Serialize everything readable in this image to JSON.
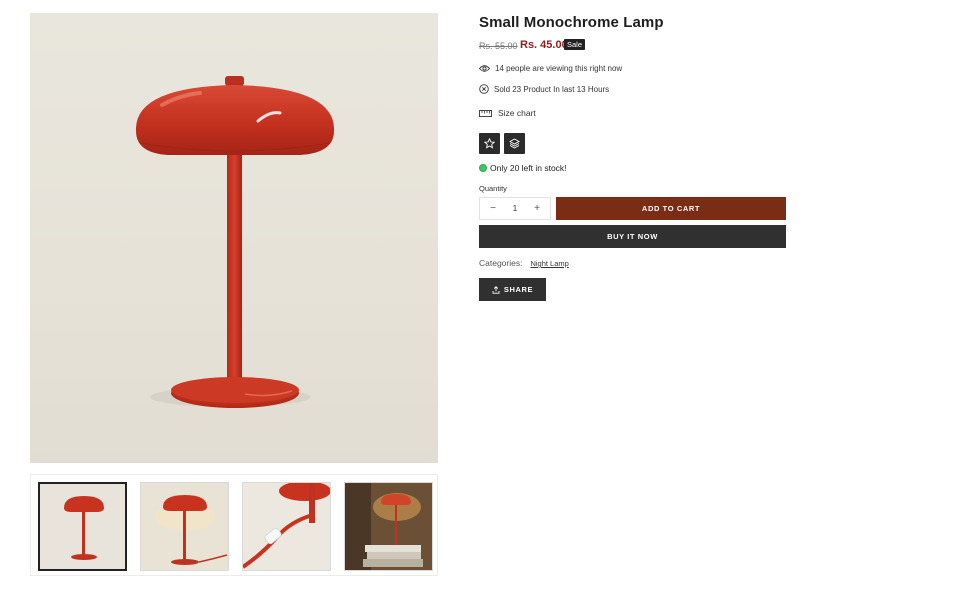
{
  "product": {
    "title": "Small Monochrome Lamp",
    "old_price": "Rs. 55.00",
    "new_price": "Rs. 45.00",
    "sale_badge": "Sale"
  },
  "info": {
    "viewing": "14 people are viewing this right now",
    "sold": "Sold 23 Product In last 13 Hours"
  },
  "size_chart_label": "Size chart",
  "icon_buttons": [
    "star-icon",
    "layers-icon"
  ],
  "stock_text": "Only 20 left in stock!",
  "quantity": {
    "label": "Quantity",
    "value": "1",
    "minus": "−",
    "plus": "+"
  },
  "actions": {
    "add_to_cart": "ADD TO CART",
    "buy_now": "BUY IT NOW",
    "share": "SHARE"
  },
  "categories": {
    "label": "Categories:",
    "value": "Night Lamp"
  },
  "colors": {
    "lamp_red": "#c8331f",
    "add_to_cart_bg": "#7a2c14",
    "dark_button_bg": "#303030",
    "price_red": "#8b1f1f",
    "stock_green": "#3cc864"
  }
}
